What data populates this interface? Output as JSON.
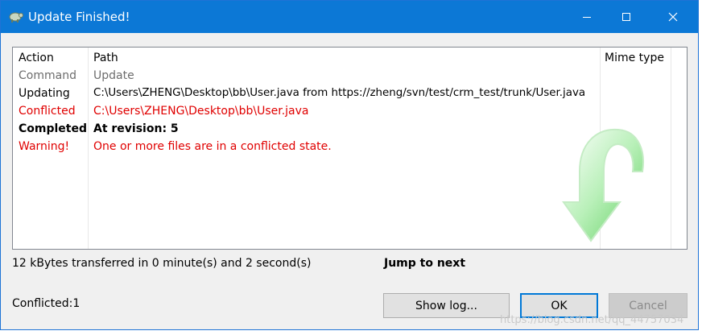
{
  "window": {
    "title": "Update Finished!"
  },
  "table": {
    "headers": {
      "action": "Action",
      "path": "Path",
      "mime": "Mime type"
    },
    "rows": [
      {
        "action": "Command",
        "path": "Update",
        "style": "gray"
      },
      {
        "action": "Updating",
        "path": "C:\\Users\\ZHENG\\Desktop\\bb\\User.java  from https://zheng/svn/test/crm_test/trunk/User.java",
        "style": "normal"
      },
      {
        "action": "Conflicted",
        "path": "C:\\Users\\ZHENG\\Desktop\\bb\\User.java",
        "style": "red"
      },
      {
        "action": "Completed",
        "path": "At revision: 5",
        "style": "bold"
      },
      {
        "action": "Warning!",
        "path": "One or more files are in a conflicted state.",
        "style": "red"
      }
    ]
  },
  "status": {
    "transfer": "12 kBytes transferred in 0 minute(s) and 2 second(s)",
    "jump": "Jump to next",
    "conflicted": "Conflicted:1"
  },
  "buttons": {
    "show_log": "Show log...",
    "ok": "OK",
    "cancel": "Cancel"
  },
  "watermark": "https://blog.csdn.net/qq_44757034",
  "colors": {
    "titlebar": "#0c78d6",
    "conflict_red": "#e00000",
    "arrow_green": "#7fdf7f"
  }
}
